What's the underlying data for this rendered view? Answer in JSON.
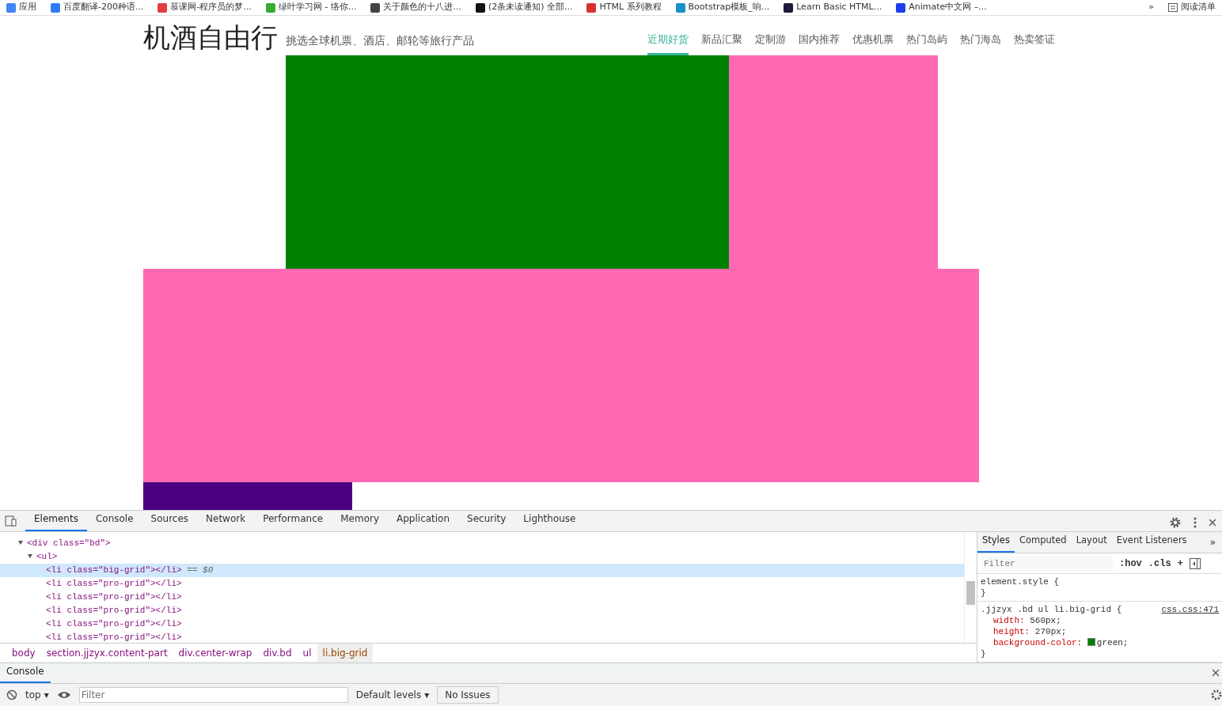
{
  "bookmarks": [
    {
      "label": "应用",
      "color": "#4285f4"
    },
    {
      "label": "百度翻译-200种语...",
      "color": "#2d7cf6"
    },
    {
      "label": "慕课网-程序员的梦...",
      "color": "#e33d3d"
    },
    {
      "label": "绿叶学习网 - 络你...",
      "color": "#3aaa35"
    },
    {
      "label": "关于颜色的十八进...",
      "color": "#444444"
    },
    {
      "label": "(2条未读通知) 全部...",
      "color": "#111111"
    },
    {
      "label": "HTML 系列教程",
      "color": "#d9322c"
    },
    {
      "label": "Bootstrap模板_响...",
      "color": "#1a8fc8"
    },
    {
      "label": "Learn Basic HTML...",
      "color": "#1b1b3a"
    },
    {
      "label": "Animate中文网 –...",
      "color": "#1a3cf0"
    }
  ],
  "bookmarks_more": "»",
  "reading_list": "阅读清单",
  "site": {
    "title": "机酒自由行",
    "subtitle": "挑选全球机票、酒店、邮轮等旅行产品",
    "nav": [
      {
        "label": "近期好货",
        "selected": true
      },
      {
        "label": "新品汇聚",
        "selected": false
      },
      {
        "label": "定制游",
        "selected": false
      },
      {
        "label": "国内推荐",
        "selected": false
      },
      {
        "label": "优惠机票",
        "selected": false
      },
      {
        "label": "热门岛屿",
        "selected": false
      },
      {
        "label": "热门海岛",
        "selected": false
      },
      {
        "label": "热卖签证",
        "selected": false
      }
    ],
    "rows": [
      {
        "blocks": [
          {
            "kind": "big",
            "color": "#008000"
          },
          {
            "kind": "small",
            "color": "#ff69b4"
          }
        ]
      },
      {
        "blocks": [
          {
            "kind": "wide",
            "color": "#ff69b4"
          }
        ]
      },
      {
        "blocks": [
          {
            "kind": "small",
            "color": "#4b0082"
          }
        ]
      }
    ]
  },
  "devtools": {
    "tabs": [
      {
        "label": "Elements",
        "selected": true
      },
      {
        "label": "Console",
        "selected": false
      },
      {
        "label": "Sources",
        "selected": false
      },
      {
        "label": "Network",
        "selected": false
      },
      {
        "label": "Performance",
        "selected": false
      },
      {
        "label": "Memory",
        "selected": false
      },
      {
        "label": "Application",
        "selected": false
      },
      {
        "label": "Security",
        "selected": false
      },
      {
        "label": "Lighthouse",
        "selected": false
      }
    ],
    "tree": [
      {
        "text": "<div class=\"bd\">",
        "expanded": true,
        "selected": false,
        "children": [
          {
            "text": "<ul>",
            "expanded": true,
            "selected": false,
            "children": [
              {
                "text": "<li class=\"big-grid\"></li>",
                "selected": true,
                "suffix": "== $0"
              },
              {
                "text": "<li class=\"pro-grid\"></li>",
                "selected": false
              },
              {
                "text": "<li class=\"pro-grid\"></li>",
                "selected": false
              },
              {
                "text": "<li class=\"pro-grid\"></li>",
                "selected": false
              },
              {
                "text": "<li class=\"pro-grid\"></li>",
                "selected": false
              },
              {
                "text": "<li class=\"pro-grid\"></li>",
                "selected": false
              }
            ]
          }
        ]
      }
    ],
    "breadcrumbs": [
      {
        "label": "body",
        "selected": false
      },
      {
        "label": "section.jjzyx.content-part",
        "selected": false
      },
      {
        "label": "div.center-wrap",
        "selected": false
      },
      {
        "label": "div.bd",
        "selected": false
      },
      {
        "label": "ul",
        "selected": false
      },
      {
        "label": "li.big-grid",
        "selected": true
      }
    ],
    "side_tabs": [
      {
        "label": "Styles",
        "selected": true
      },
      {
        "label": "Computed",
        "selected": false
      },
      {
        "label": "Layout",
        "selected": false
      },
      {
        "label": "Event Listeners",
        "selected": false
      }
    ],
    "side_more": "»",
    "styles_filter": {
      "placeholder": "Filter"
    },
    "hov": ":hov",
    "cls": ".cls",
    "plus": "+",
    "rules": [
      {
        "selector": "element.style {",
        "close": "}"
      },
      {
        "selector": ".jjzyx .bd ul li.big-grid {",
        "source": "css.css:471",
        "close": "}",
        "declarations": [
          {
            "property": "width:",
            "value": "560px;"
          },
          {
            "property": "height:",
            "value": "270px;"
          },
          {
            "property": "background-color:",
            "value": "green;",
            "color": "#008000"
          }
        ]
      }
    ],
    "drawer_tab": "Console",
    "console": {
      "context": "top",
      "context_caret": "▾",
      "filter": {
        "placeholder": "Filter"
      },
      "levels": "Default levels",
      "levels_caret": "▾",
      "issues": "No Issues"
    }
  }
}
